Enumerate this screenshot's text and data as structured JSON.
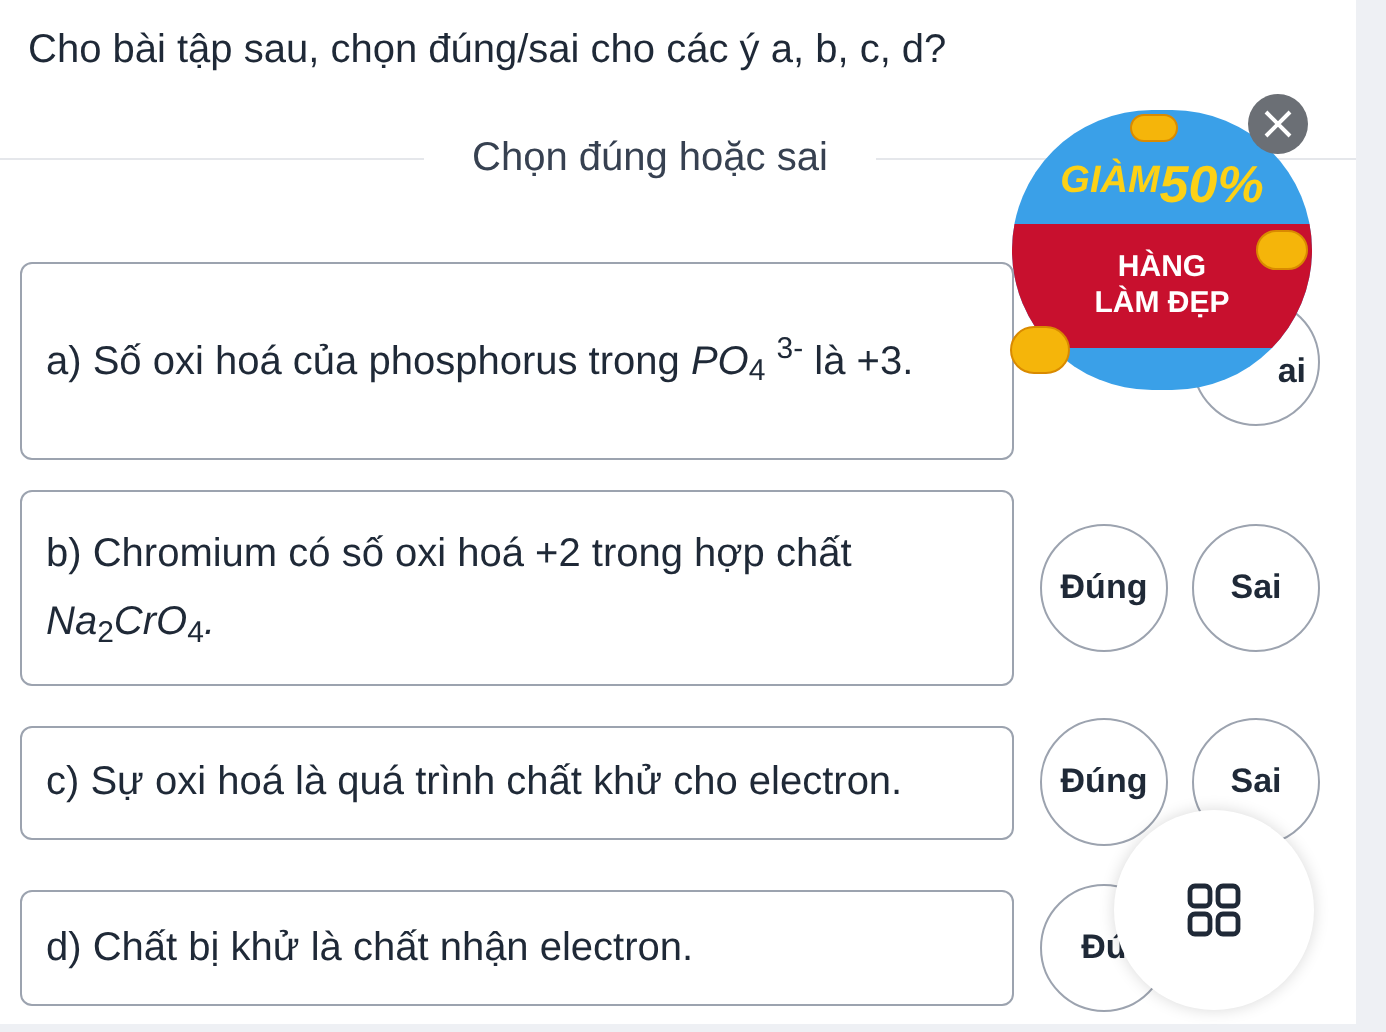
{
  "question": "Cho bài tập sau, chọn đúng/sai cho các ý a, b, c, d?",
  "section_title": "Chọn đúng hoặc sai",
  "statements": [
    {
      "text": "a) Số oxi hoá của phosphorus trong *PO*$_{4}$ $^{3-}$ là +3.",
      "options": [
        {
          "kind": "covered"
        },
        {
          "kind": "partial",
          "label": "ai"
        }
      ]
    },
    {
      "text": "b) Chromium có số oxi hoá +2 trong hợp chất *Na*$_{2}$*CrO*$_{4}$*.*",
      "options": [
        {
          "kind": "button",
          "label": "Đúng"
        },
        {
          "kind": "button",
          "label": "Sai"
        }
      ]
    },
    {
      "text": "c) Sự oxi hoá là quá trình chất khử cho electron.",
      "options": [
        {
          "kind": "button",
          "label": "Đúng"
        },
        {
          "kind": "button",
          "label": "Sai"
        }
      ]
    },
    {
      "text": "d) Chất bị khử là chất nhận electron.",
      "options": [
        {
          "kind": "button",
          "label": "Đú"
        },
        {
          "kind": "covered"
        }
      ]
    }
  ],
  "promo": {
    "headline": "GIÀM",
    "discount": "50%",
    "line_1": "HÀNG",
    "line_2": "LÀM ĐẸP"
  }
}
